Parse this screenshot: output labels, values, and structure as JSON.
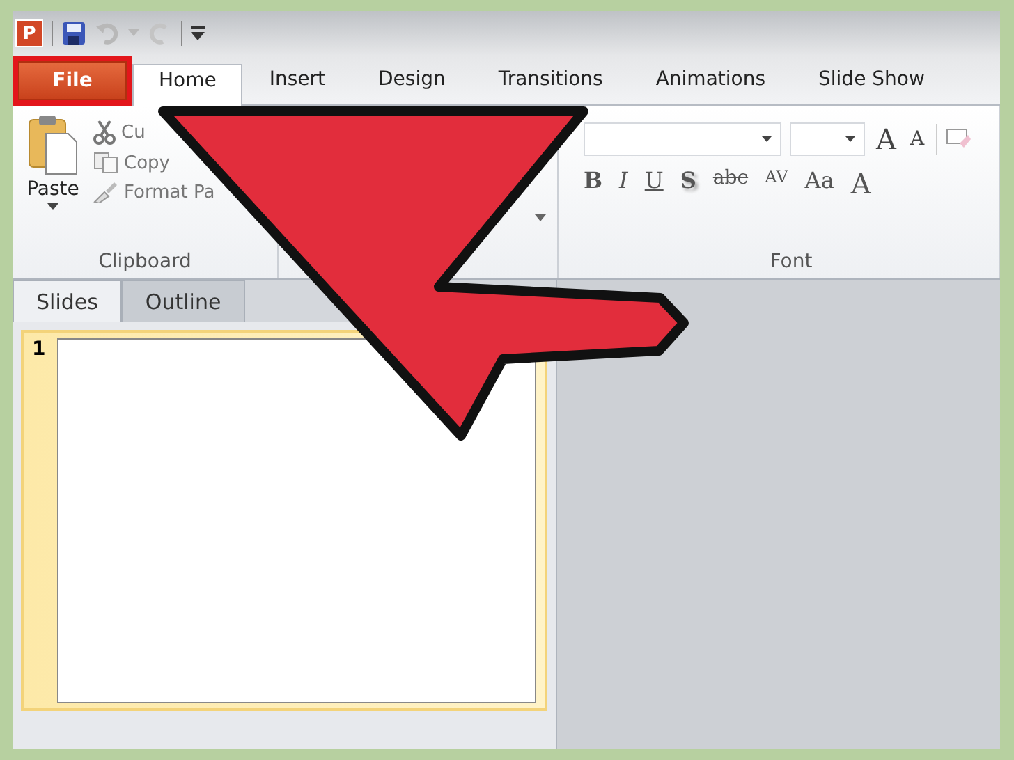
{
  "app_icon": {
    "letter": "P"
  },
  "tabs": [
    {
      "label": "File",
      "kind": "file",
      "selected": false,
      "highlighted": true
    },
    {
      "label": "Home",
      "kind": "tab",
      "selected": true,
      "highlighted": false
    },
    {
      "label": "Insert",
      "kind": "tab",
      "selected": false,
      "highlighted": false
    },
    {
      "label": "Design",
      "kind": "tab",
      "selected": false,
      "highlighted": false
    },
    {
      "label": "Transitions",
      "kind": "tab",
      "selected": false,
      "highlighted": false
    },
    {
      "label": "Animations",
      "kind": "tab",
      "selected": false,
      "highlighted": false
    },
    {
      "label": "Slide Show",
      "kind": "tab",
      "selected": false,
      "highlighted": false
    }
  ],
  "clipboard": {
    "paste": "Paste",
    "items": [
      {
        "label": "Cu",
        "kind": "cut"
      },
      {
        "label": "Copy",
        "kind": "copy"
      },
      {
        "label": "Format Pa",
        "kind": "brush"
      }
    ],
    "group_label": "Clipboard"
  },
  "font": {
    "size_buttons": [
      "A",
      "A"
    ],
    "format_buttons": [
      {
        "label": "B",
        "kind": "bold"
      },
      {
        "label": "I",
        "kind": "italic"
      },
      {
        "label": "U",
        "kind": "underline"
      },
      {
        "label": "S",
        "kind": "shadow"
      },
      {
        "label": "abc",
        "kind": "strike"
      },
      {
        "label": "AV",
        "kind": "spacing"
      },
      {
        "label": "Aa",
        "kind": "case"
      },
      {
        "label": "A",
        "kind": "color"
      }
    ],
    "group_label": "Font"
  },
  "pane_tabs": [
    {
      "label": "Slides",
      "selected": true
    },
    {
      "label": "Outline",
      "selected": false
    }
  ],
  "slides": [
    {
      "number": "1",
      "selected": true
    }
  ]
}
